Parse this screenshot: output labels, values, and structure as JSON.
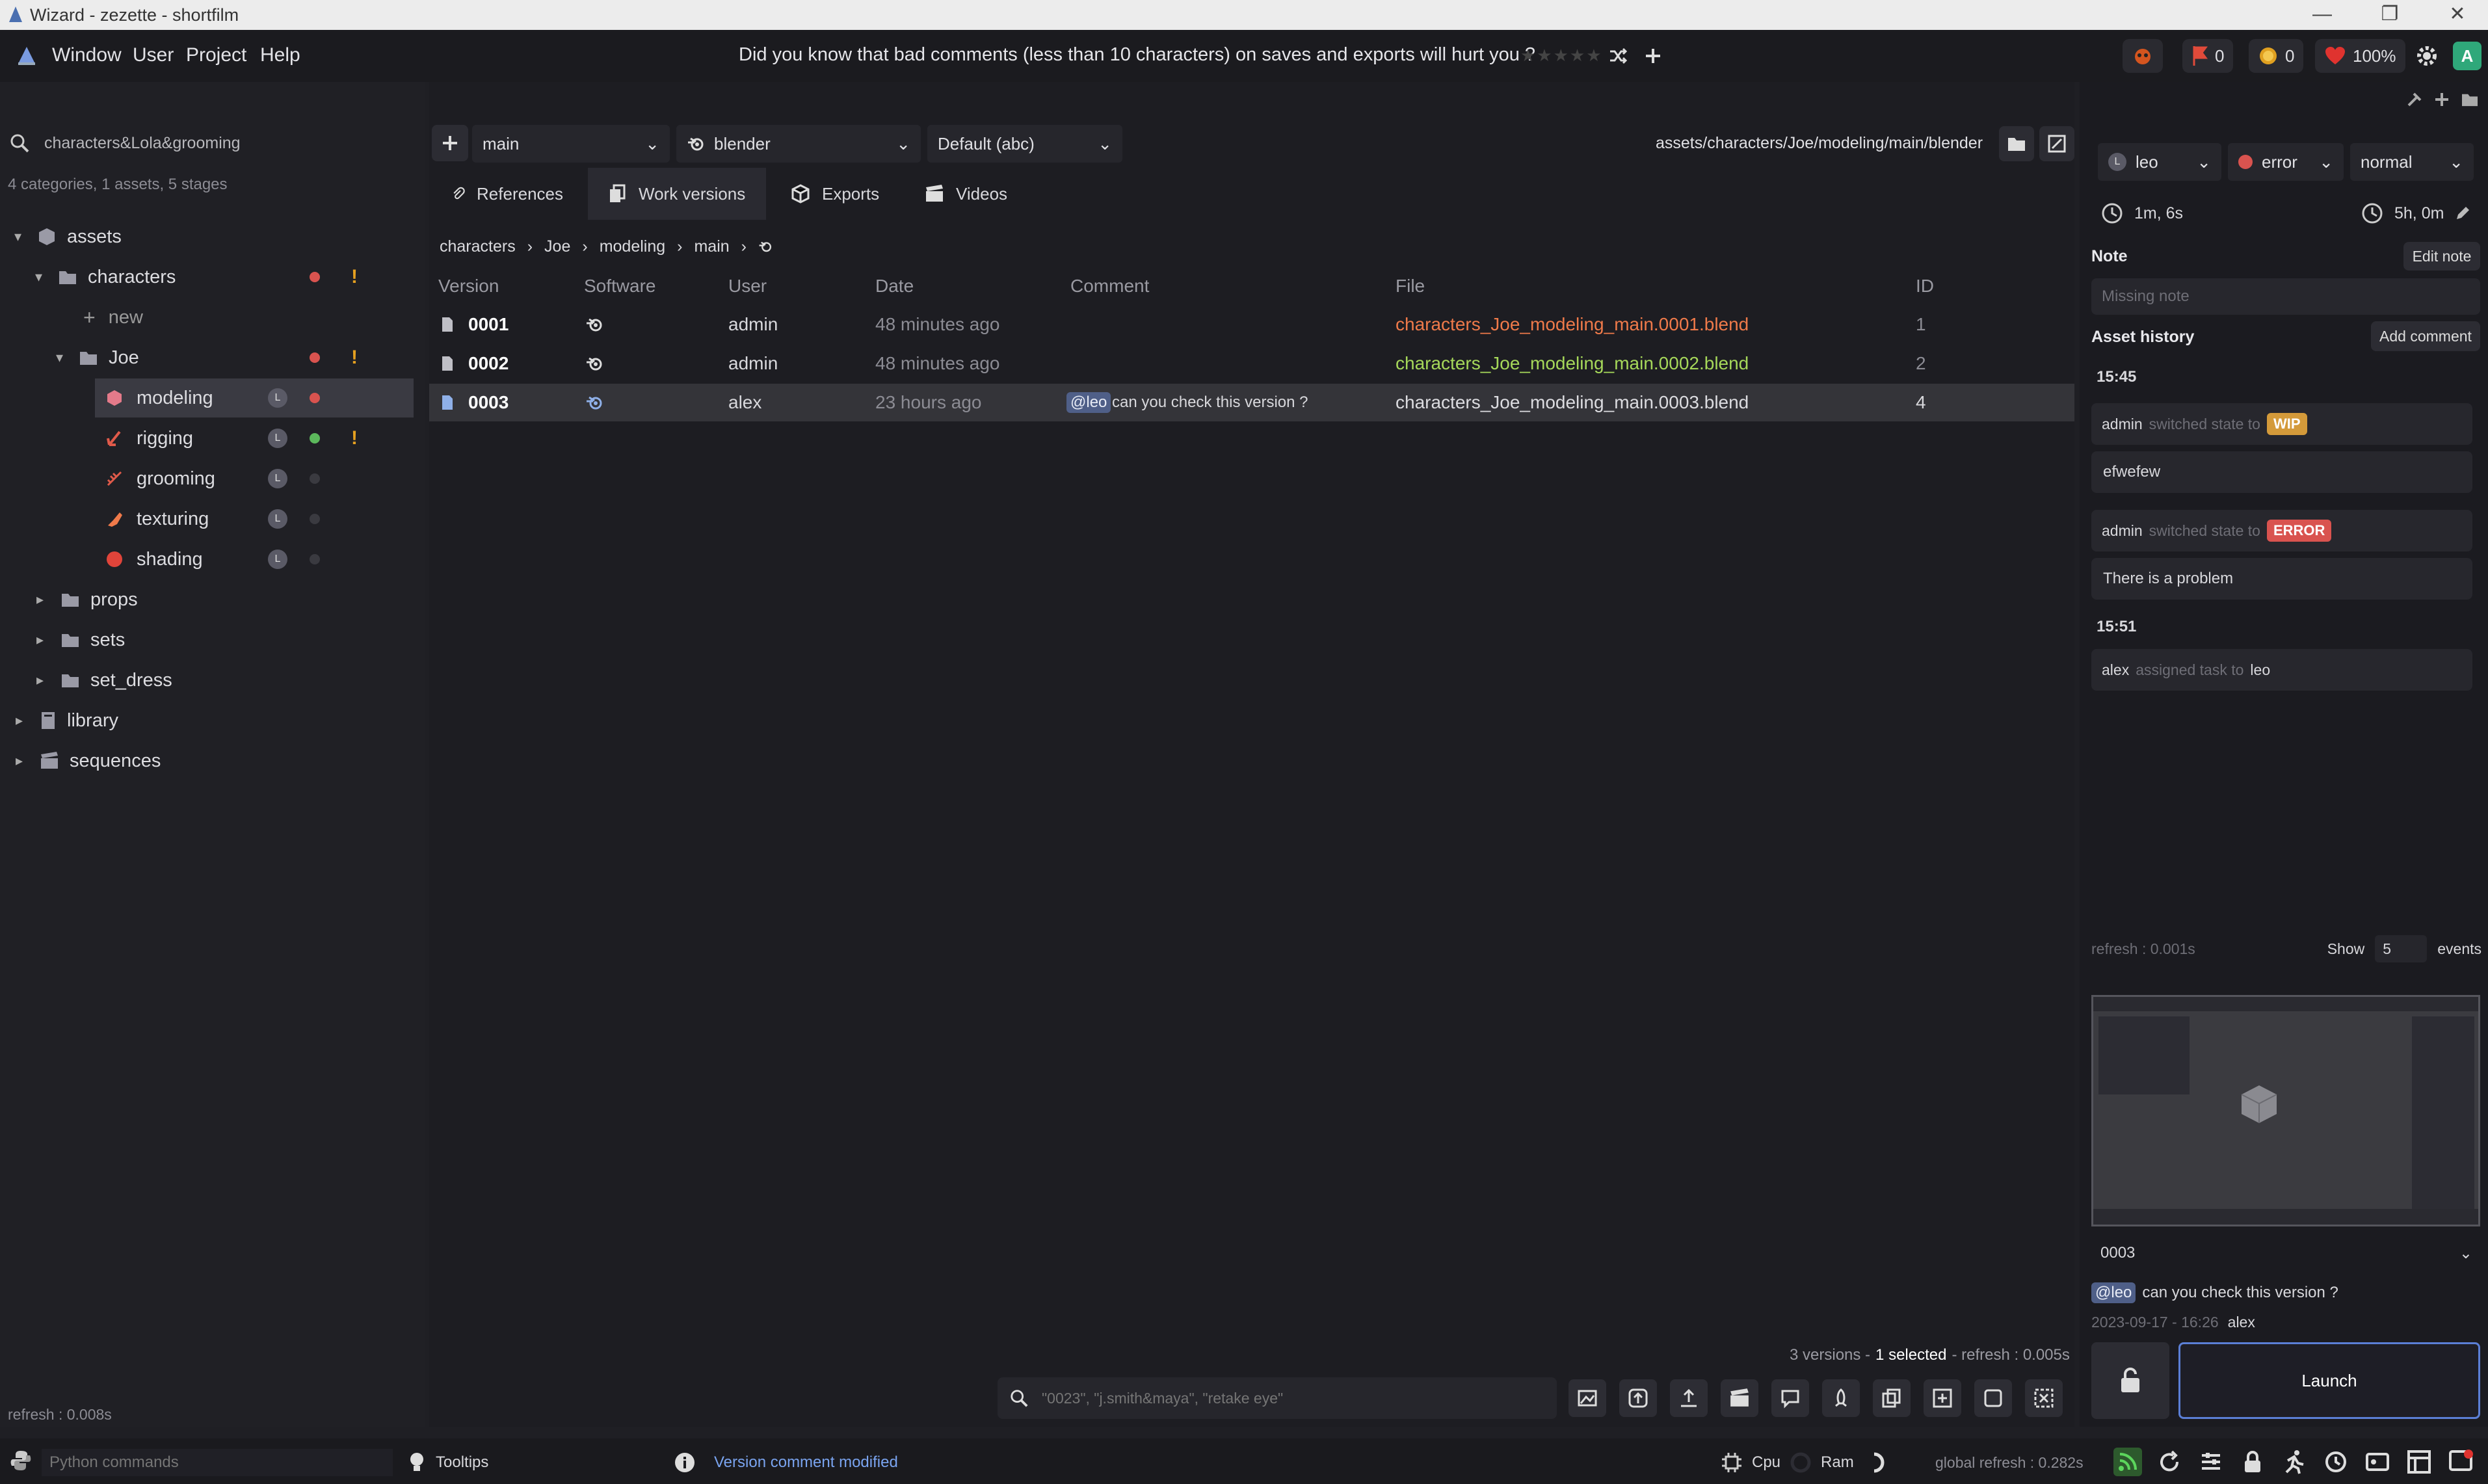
{
  "window": {
    "title": "Wizard - zezette - shortfilm",
    "minimize_glyph": "—",
    "restore_glyph": "❐",
    "close_glyph": "✕"
  },
  "menu": {
    "items": [
      "Window",
      "User",
      "Project",
      "Help"
    ]
  },
  "tip": {
    "text": "Did you know that bad comments (less than 10 characters) on saves and exports will hurt you ?",
    "stars": "★★★★★"
  },
  "counters": {
    "flags": "0",
    "coins": "0",
    "life": "100%",
    "avatar": "A"
  },
  "left": {
    "search_value": "characters&Lola&grooming",
    "summary": "4 categories, 1 assets, 5 stages",
    "refresh": "refresh : 0.008s",
    "tree": {
      "assets": "assets",
      "characters": "characters",
      "new": "new",
      "joe": "Joe",
      "modeling": "modeling",
      "rigging": "rigging",
      "grooming": "grooming",
      "texturing": "texturing",
      "shading": "shading",
      "props": "props",
      "sets": "sets",
      "set_dress": "set_dress",
      "library": "library",
      "sequences": "sequences",
      "lock_letter": "L",
      "excl": "!"
    }
  },
  "center": {
    "variant": "main",
    "software": "blender",
    "preset": "Default (abc)",
    "path": "assets/characters/Joe/modeling/main/blender",
    "tabs": [
      "References",
      "Work versions",
      "Exports",
      "Videos"
    ],
    "breadcrumb": [
      "characters",
      "Joe",
      "modeling",
      "main"
    ],
    "columns": [
      "Version",
      "Software",
      "User",
      "Date",
      "Comment",
      "File",
      "ID"
    ],
    "versions": [
      {
        "version": "0001",
        "user": "admin",
        "date": "48 minutes ago",
        "mention": "",
        "comment": "",
        "file": "characters_Joe_modeling_main.0001.blend",
        "file_color": "#ef7a4a",
        "id": "1"
      },
      {
        "version": "0002",
        "user": "admin",
        "date": "48 minutes ago",
        "mention": "",
        "comment": "",
        "file": "characters_Joe_modeling_main.0002.blend",
        "file_color": "#a6d85a",
        "id": "2"
      },
      {
        "version": "0003",
        "user": "alex",
        "date": "23 hours ago",
        "mention": "@leo",
        "comment": "can you check this version ?",
        "file": "characters_Joe_modeling_main.0003.blend",
        "file_color": "#dcdce0",
        "id": "4"
      }
    ],
    "footer": {
      "count": "3 versions -",
      "selected": "1 selected",
      "refresh": "- refresh : 0.005s"
    },
    "search_placeholder": "\"0023\", \"j.smith&maya\", \"retake eye\""
  },
  "right": {
    "assignee": "leo",
    "state": "error",
    "priority": "normal",
    "time_spent": "1m, 6s",
    "estimate": "5h, 0m",
    "note_label": "Note",
    "edit_note": "Edit note",
    "note_value": "Missing note",
    "history_label": "Asset history",
    "add_comment": "Add comment",
    "history": {
      "time1": "15:45",
      "e1_user": "admin",
      "e1_text": "switched state to",
      "e1_state": "WIP",
      "e1_comment": "efwefew",
      "e2_user": "admin",
      "e2_text": "switched state to",
      "e2_state": "ERROR",
      "e2_comment": "There is a problem",
      "time2": "15:51",
      "e3_user": "alex",
      "e3_text": "assigned task to",
      "e3_target": "leo"
    },
    "refresh": "refresh : 0.001s",
    "show_label": "Show",
    "show_value": "5",
    "events_label": "events",
    "preview_version": "0003",
    "preview_mention": "@leo",
    "preview_comment": "can you check this version ?",
    "preview_date": "2023-09-17 - 16:26",
    "preview_user": "alex",
    "launch": "Launch",
    "colors": {
      "wip": "#d49a3a",
      "error": "#d9534f",
      "accent": "#5b7fd6"
    }
  },
  "status": {
    "python_placeholder": "Python commands",
    "tooltips": "Tooltips",
    "message": "Version comment modified",
    "cpu": "Cpu",
    "ram": "Ram",
    "global_refresh": "global refresh : 0.282s"
  }
}
